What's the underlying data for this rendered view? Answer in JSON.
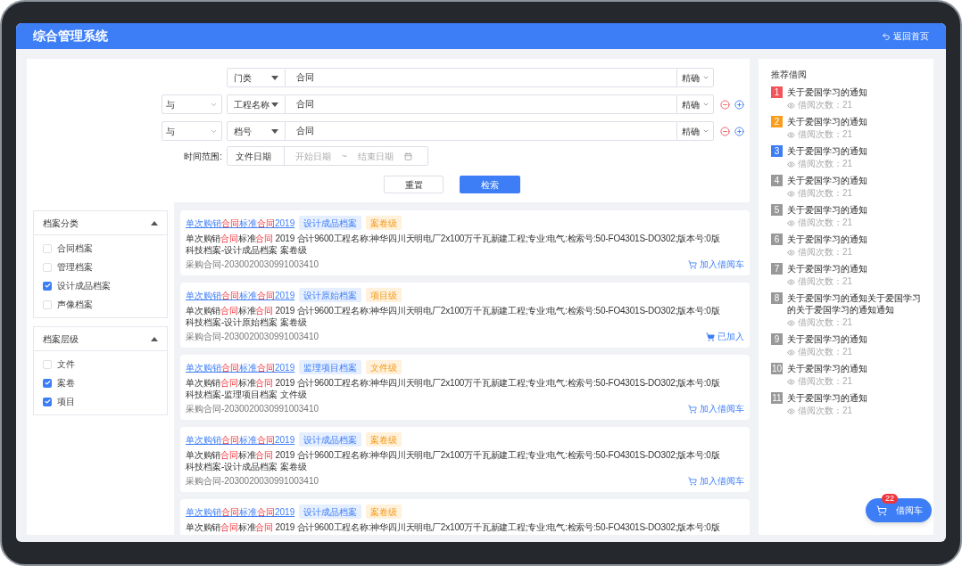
{
  "header": {
    "title": "综合管理系统",
    "back_link": "返回首页"
  },
  "search": {
    "rows": [
      {
        "field": "门类",
        "value": "合同",
        "match": "精确"
      },
      {
        "logic": "与",
        "field": "工程名称",
        "value": "合同",
        "match": "精确",
        "removable": true,
        "addable": true
      },
      {
        "logic": "与",
        "field": "档号",
        "value": "合同",
        "match": "精确",
        "removable": true,
        "addable": true
      }
    ],
    "date_range": {
      "label": "时间范围:",
      "field": "文件日期",
      "start_placeholder": "开始日期",
      "separator": "~",
      "end_placeholder": "结束日期"
    },
    "reset_button": "重置",
    "search_button": "检索"
  },
  "filters": [
    {
      "title": "档案分类",
      "expanded": true,
      "options": [
        {
          "label": "合同档案",
          "checked": false
        },
        {
          "label": "管理档案",
          "checked": false
        },
        {
          "label": "设计成品档案",
          "checked": true
        },
        {
          "label": "声像档案",
          "checked": false
        }
      ]
    },
    {
      "title": "档案层级",
      "expanded": true,
      "options": [
        {
          "label": "文件",
          "checked": false
        },
        {
          "label": "案卷",
          "checked": true
        },
        {
          "label": "项目",
          "checked": true
        }
      ]
    }
  ],
  "results": [
    {
      "title": [
        {
          "text": "单次购销",
          "hit": false
        },
        {
          "text": "合同",
          "hit": true
        },
        {
          "text": "标准",
          "hit": false
        },
        {
          "text": "合同",
          "hit": true
        },
        {
          "text": "2019",
          "hit": false
        }
      ],
      "tags": [
        {
          "kind": "category",
          "label": "设计成品档案"
        },
        {
          "kind": "level",
          "label": "案卷级"
        }
      ],
      "description": [
        {
          "text": "单次购销",
          "hit": false
        },
        {
          "text": "合同",
          "hit": true
        },
        {
          "text": "标准",
          "hit": false
        },
        {
          "text": "合同",
          "hit": true
        },
        {
          "text": " 2019 合计9600工程名称:神华四川天明电厂2x100万千瓦新建工程;专业:电气:检索号:50-FO4301S-DO302;版本号:0版",
          "hit": false
        }
      ],
      "category_line": "科技档案-设计成品档案 案卷级",
      "code": "采购合同-2030020030991003410",
      "action": {
        "label": "加入借阅车",
        "added": false
      }
    },
    {
      "title": [
        {
          "text": "单次购销",
          "hit": false
        },
        {
          "text": "合同",
          "hit": true
        },
        {
          "text": "标准",
          "hit": false
        },
        {
          "text": "合同",
          "hit": true
        },
        {
          "text": "2019",
          "hit": false
        }
      ],
      "tags": [
        {
          "kind": "category",
          "label": "设计原始档案"
        },
        {
          "kind": "level",
          "label": "项目级"
        }
      ],
      "description": [
        {
          "text": "单次购销",
          "hit": false
        },
        {
          "text": "合同",
          "hit": true
        },
        {
          "text": "标准",
          "hit": false
        },
        {
          "text": "合同",
          "hit": true
        },
        {
          "text": " 2019 合计9600工程名称:神华四川天明电厂2x100万千瓦新建工程;专业:电气:检索号:50-FO4301S-DO302;版本号:0版",
          "hit": false
        }
      ],
      "category_line": "科技档案-设计原始档案 案卷级",
      "code": "采购合同-2030020030991003410",
      "action": {
        "label": "已加入",
        "added": true
      }
    },
    {
      "title": [
        {
          "text": "单次购销",
          "hit": false
        },
        {
          "text": "合同",
          "hit": true
        },
        {
          "text": "标准",
          "hit": false
        },
        {
          "text": "合同",
          "hit": true
        },
        {
          "text": "2019",
          "hit": false
        }
      ],
      "tags": [
        {
          "kind": "category",
          "label": "监理项目档案"
        },
        {
          "kind": "level",
          "label": "文件级"
        }
      ],
      "description": [
        {
          "text": "单次购销",
          "hit": false
        },
        {
          "text": "合同",
          "hit": true
        },
        {
          "text": "标准",
          "hit": false
        },
        {
          "text": "合同",
          "hit": true
        },
        {
          "text": " 2019 合计9600工程名称:神华四川天明电厂2x100万千瓦新建工程;专业:电气:检索号:50-FO4301S-DO302;版本号:0版",
          "hit": false
        }
      ],
      "category_line": "科技档案-监理项目档案 文件级",
      "code": "采购合同-2030020030991003410",
      "action": {
        "label": "加入借阅车",
        "added": false
      }
    },
    {
      "title": [
        {
          "text": "单次购销",
          "hit": false
        },
        {
          "text": "合同",
          "hit": true
        },
        {
          "text": "标准",
          "hit": false
        },
        {
          "text": "合同",
          "hit": true
        },
        {
          "text": "2019",
          "hit": false
        }
      ],
      "tags": [
        {
          "kind": "category",
          "label": "设计成品档案"
        },
        {
          "kind": "level",
          "label": "案卷级"
        }
      ],
      "description": [
        {
          "text": "单次购销",
          "hit": false
        },
        {
          "text": "合同",
          "hit": true
        },
        {
          "text": "标准",
          "hit": false
        },
        {
          "text": "合同",
          "hit": true
        },
        {
          "text": " 2019 合计9600工程名称:神华四川天明电厂2x100万千瓦新建工程;专业:电气:检索号:50-FO4301S-DO302;版本号:0版",
          "hit": false
        }
      ],
      "category_line": "科技档案-设计成品档案 案卷级",
      "code": "采购合同-2030020030991003410",
      "action": {
        "label": "加入借阅车",
        "added": false
      }
    },
    {
      "title": [
        {
          "text": "单次购销",
          "hit": false
        },
        {
          "text": "合同",
          "hit": true
        },
        {
          "text": "标准",
          "hit": false
        },
        {
          "text": "合同",
          "hit": true
        },
        {
          "text": "2019",
          "hit": false
        }
      ],
      "tags": [
        {
          "kind": "category",
          "label": "设计成品档案"
        },
        {
          "kind": "level",
          "label": "案卷级"
        }
      ],
      "description": [
        {
          "text": "单次购销",
          "hit": false
        },
        {
          "text": "合同",
          "hit": true
        },
        {
          "text": "标准",
          "hit": false
        },
        {
          "text": "合同",
          "hit": true
        },
        {
          "text": " 2019 合计9600工程名称:神华四川天明电厂2x100万千瓦新建工程;专业:电气:检索号:50-FO4301S-DO302;版本号:0版",
          "hit": false
        }
      ]
    }
  ],
  "recommend": {
    "title": "推荐借阅",
    "items": [
      {
        "rank": "1",
        "color": "#f0555b",
        "title": "关于爱国学习的通知",
        "count": "借阅次数：21"
      },
      {
        "rank": "2",
        "color": "#fa9d1c",
        "title": "关于爱国学习的通知",
        "count": "借阅次数：21"
      },
      {
        "rank": "3",
        "color": "#3d7ef7",
        "title": "关于爱国学习的通知",
        "count": "借阅次数：21"
      },
      {
        "rank": "4",
        "color": "#999999",
        "title": "关于爱国学习的通知",
        "count": "借阅次数：21"
      },
      {
        "rank": "5",
        "color": "#999999",
        "title": "关于爱国学习的通知",
        "count": "借阅次数：21"
      },
      {
        "rank": "6",
        "color": "#999999",
        "title": "关于爱国学习的通知",
        "count": "借阅次数：21"
      },
      {
        "rank": "7",
        "color": "#999999",
        "title": "关于爱国学习的通知",
        "count": "借阅次数：21"
      },
      {
        "rank": "8",
        "color": "#999999",
        "title": "关于爱国学习的通知关于爱国学习的关于爱国学习的通知通知",
        "count": "借阅次数：21"
      },
      {
        "rank": "9",
        "color": "#999999",
        "title": "关于爱国学习的通知",
        "count": "借阅次数：21"
      },
      {
        "rank": "10",
        "color": "#999999",
        "title": "关于爱国学习的通知",
        "count": "借阅次数：21"
      },
      {
        "rank": "11",
        "color": "#999999",
        "title": "关于爱国学习的通知",
        "count": "借阅次数：21"
      }
    ]
  },
  "cart": {
    "label": "借阅车",
    "badge": "22"
  }
}
